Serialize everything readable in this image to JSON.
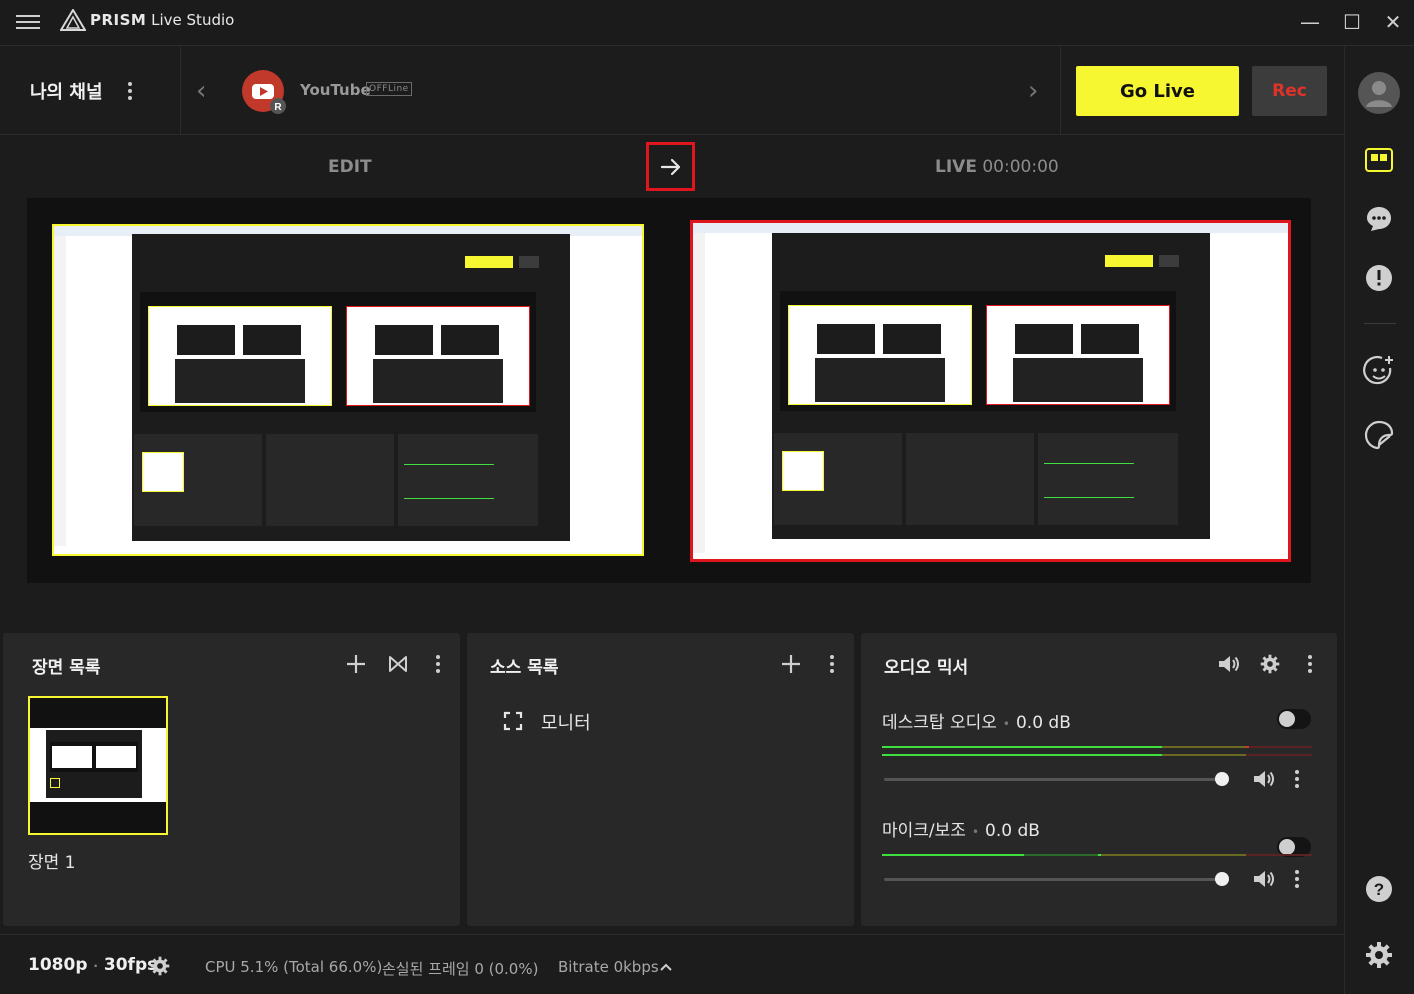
{
  "app": {
    "brand": "PRISM",
    "title": "Live Studio"
  },
  "window": {
    "minimize": "—",
    "maximize": "☐",
    "close": "✕"
  },
  "channel": {
    "name": "나의 채널",
    "platform": "YouTube",
    "status": "OFFLine",
    "badge_letter": "R"
  },
  "actions": {
    "go_live": "Go Live",
    "rec": "Rec"
  },
  "studio": {
    "edit_label": "EDIT",
    "live_label": "LIVE",
    "live_time": "00:00:00"
  },
  "scenes": {
    "title": "장면 목록",
    "items": [
      {
        "label": "장면 1"
      }
    ]
  },
  "sources": {
    "title": "소스 목록",
    "items": [
      {
        "label": "모니터"
      }
    ]
  },
  "mixer": {
    "title": "오디오 믹서",
    "channels": [
      {
        "name": "데스크탑 오디오",
        "level": "0.0 dB",
        "volume": 1.0
      },
      {
        "name": "마이크/보조",
        "level": "0.0 dB",
        "volume": 1.0
      }
    ]
  },
  "status": {
    "resolution": "1080p",
    "fps": "30fps",
    "cpu": "CPU 5.1% (Total 66.0%)",
    "dropped": "손실된 프레임 0 (0.0%)",
    "bitrate": "Bitrate 0kbps"
  },
  "colors": {
    "accent_yellow": "#f6f730",
    "live_red": "#e0161e",
    "rec_red": "#e0322b",
    "meter_green": "#3ee03e"
  },
  "icons": [
    "menu-icon",
    "prism-logo-icon",
    "kebab-icon",
    "chevron-left-icon",
    "chevron-right-icon",
    "youtube-icon",
    "avatar-icon",
    "layout-icon",
    "chat-icon",
    "alert-icon",
    "sticker-icon",
    "beauty-icon",
    "help-icon",
    "settings-icon",
    "arrow-right-icon",
    "plus-icon",
    "transition-icon",
    "monitor-icon",
    "speaker-icon",
    "gear-icon",
    "chevron-up-icon"
  ]
}
